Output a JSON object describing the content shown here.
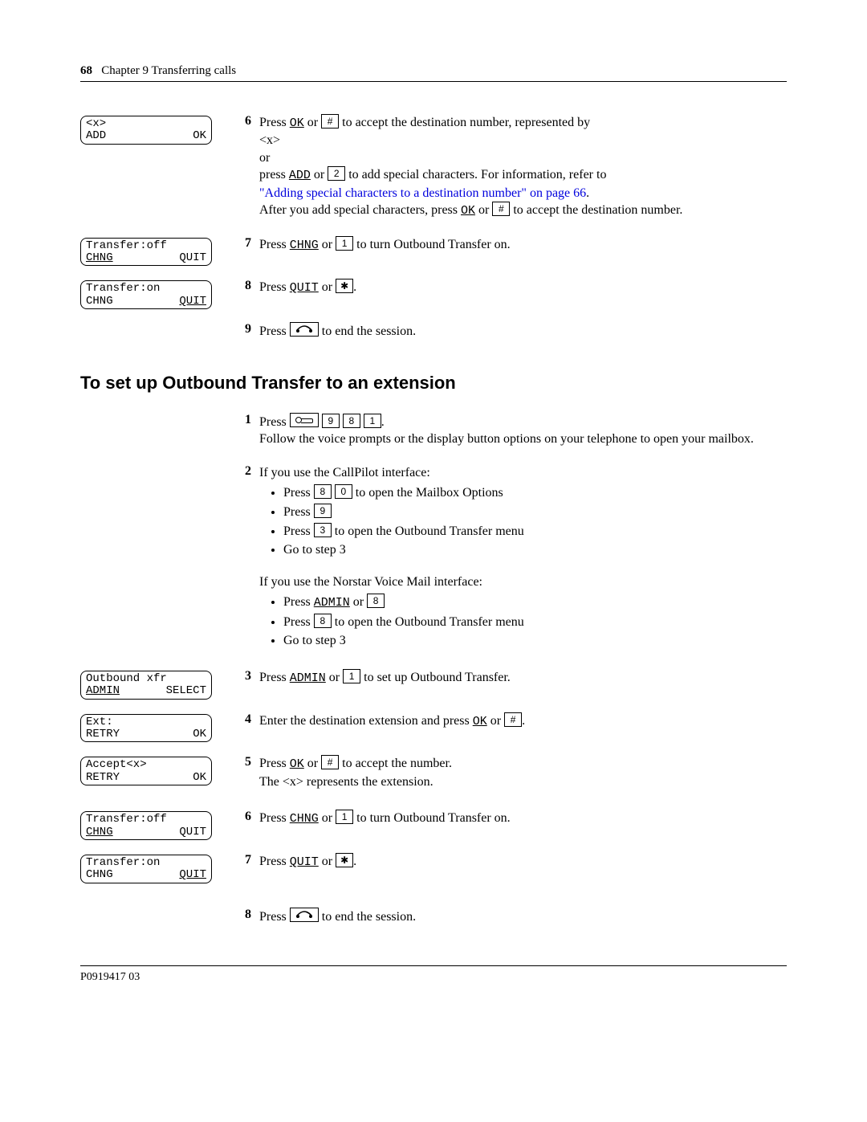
{
  "header": {
    "page": "68",
    "chapter": "Chapter 9  Transferring calls"
  },
  "lcd": {
    "a": {
      "l1": "<x>",
      "left": "ADD",
      "right": "OK"
    },
    "b": {
      "l1": "Transfer:off",
      "left": "CHNG",
      "right": "QUIT"
    },
    "c": {
      "l1": "Transfer:on",
      "left": "CHNG",
      "right": "QUIT"
    },
    "d": {
      "l1": "Outbound xfr",
      "left": "ADMIN",
      "right": "SELECT"
    },
    "e": {
      "l1": "Ext:",
      "left": "RETRY",
      "right": "OK"
    },
    "f": {
      "l1": "Accept<x>",
      "left": "RETRY",
      "right": "OK"
    },
    "g": {
      "l1": "Transfer:off",
      "left": "CHNG",
      "right": "QUIT"
    },
    "h": {
      "l1": "Transfer:on",
      "left": "CHNG",
      "right": "QUIT"
    }
  },
  "soft": {
    "ok": "OK",
    "add": "ADD",
    "chng": "CHNG",
    "quit": "QUIT",
    "admin": "ADMIN"
  },
  "keys": {
    "hash": "#",
    "two": "2",
    "one": "1",
    "star": "✱",
    "nine": "9",
    "eight": "8",
    "zero": "0",
    "three": "3"
  },
  "s6": {
    "a": "Press ",
    "b": " or ",
    "c": " to accept the destination number, represented by ",
    "d": "<x>",
    "e": "or",
    "f": "press ",
    "g": " or ",
    "h": " to add special characters. For information, refer to ",
    "link": "\"Adding special characters to a destination number\" on page 66",
    "i": ".",
    "j": "After you add special characters, press ",
    "k": " or ",
    "l": " to accept the destination number."
  },
  "s7": {
    "a": "Press ",
    "b": " or ",
    "c": " to turn Outbound Transfer on."
  },
  "s8": {
    "a": "Press ",
    "b": " or ",
    "c": "."
  },
  "s9": {
    "a": "Press ",
    "b": " to end the session."
  },
  "heading": "To set up Outbound Transfer to an extension",
  "t1": {
    "a": "Press ",
    "b": ".",
    "c": "Follow the voice prompts or the display button options on your telephone to open your mailbox."
  },
  "t2": {
    "intro": "If you use the CallPilot interface:",
    "b1a": "Press ",
    "b1b": " to open the Mailbox Options",
    "b2a": "Press ",
    "b3a": "Press ",
    "b3b": " to open the Outbound Transfer menu",
    "b4": "Go to step 3",
    "alt": "If you use the Norstar Voice Mail interface:",
    "c1a": "Press ",
    "c1b": " or ",
    "c2a": "Press ",
    "c2b": " to open the Outbound Transfer menu",
    "c3": "Go to step 3"
  },
  "t3": {
    "a": "Press ",
    "b": " or ",
    "c": " to set up Outbound Transfer."
  },
  "t4": {
    "a": "Enter the destination extension and press ",
    "b": " or ",
    "c": "."
  },
  "t5": {
    "a": "Press ",
    "b": " or ",
    "c": " to accept the number.",
    "d": "The <x> represents the extension."
  },
  "t6": {
    "a": "Press ",
    "b": " or ",
    "c": " to turn Outbound Transfer on."
  },
  "t7": {
    "a": "Press ",
    "b": " or ",
    "c": "."
  },
  "t8": {
    "a": "Press ",
    "b": " to end the session."
  },
  "nums": {
    "n6": "6",
    "n7": "7",
    "n8": "8",
    "n9": "9",
    "n1": "1",
    "n2": "2",
    "n3": "3",
    "n4": "4",
    "n5": "5"
  },
  "footer": "P0919417 03"
}
